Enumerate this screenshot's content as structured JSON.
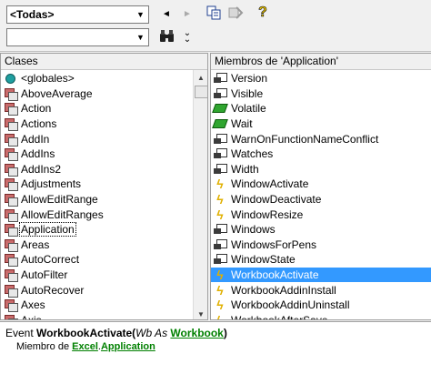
{
  "toolbar": {
    "library_value": "<Todas>",
    "search_value": "",
    "back_glyph": "◄",
    "forward_glyph": "►",
    "help_glyph": "?"
  },
  "classes": {
    "header": "Clases",
    "items": [
      {
        "label": "<globales>",
        "icon": "globals-icon"
      },
      {
        "label": "AboveAverage",
        "icon": "class-icon"
      },
      {
        "label": "Action",
        "icon": "class-icon"
      },
      {
        "label": "Actions",
        "icon": "class-icon"
      },
      {
        "label": "AddIn",
        "icon": "class-icon"
      },
      {
        "label": "AddIns",
        "icon": "class-icon"
      },
      {
        "label": "AddIns2",
        "icon": "class-icon"
      },
      {
        "label": "Adjustments",
        "icon": "class-icon"
      },
      {
        "label": "AllowEditRange",
        "icon": "class-icon"
      },
      {
        "label": "AllowEditRanges",
        "icon": "class-icon"
      },
      {
        "label": "Application",
        "icon": "class-icon",
        "selected": true
      },
      {
        "label": "Areas",
        "icon": "class-icon"
      },
      {
        "label": "AutoCorrect",
        "icon": "class-icon"
      },
      {
        "label": "AutoFilter",
        "icon": "class-icon"
      },
      {
        "label": "AutoRecover",
        "icon": "class-icon"
      },
      {
        "label": "Axes",
        "icon": "class-icon"
      },
      {
        "label": "Axis",
        "icon": "class-icon"
      }
    ]
  },
  "members": {
    "header": "Miembros de 'Application'",
    "items": [
      {
        "label": "Version",
        "icon": "property-icon"
      },
      {
        "label": "Visible",
        "icon": "property-icon"
      },
      {
        "label": "Volatile",
        "icon": "method-icon"
      },
      {
        "label": "Wait",
        "icon": "method-icon"
      },
      {
        "label": "WarnOnFunctionNameConflict",
        "icon": "property-icon"
      },
      {
        "label": "Watches",
        "icon": "property-icon"
      },
      {
        "label": "Width",
        "icon": "property-icon"
      },
      {
        "label": "WindowActivate",
        "icon": "event-icon"
      },
      {
        "label": "WindowDeactivate",
        "icon": "event-icon"
      },
      {
        "label": "WindowResize",
        "icon": "event-icon"
      },
      {
        "label": "Windows",
        "icon": "property-icon"
      },
      {
        "label": "WindowsForPens",
        "icon": "property-icon"
      },
      {
        "label": "WindowState",
        "icon": "property-icon"
      },
      {
        "label": "WorkbookActivate",
        "icon": "event-icon",
        "highlight": true
      },
      {
        "label": "WorkbookAddinInstall",
        "icon": "event-icon"
      },
      {
        "label": "WorkbookAddinUninstall",
        "icon": "event-icon"
      },
      {
        "label": "WorkbookAfterSave",
        "icon": "event-icon"
      }
    ]
  },
  "details": {
    "kind": "Event ",
    "name": "WorkbookActivate",
    "open_paren": "(",
    "param": "Wb As ",
    "type": "Workbook",
    "close_paren": ")",
    "member_of_label": "Miembro de ",
    "library": "Excel",
    "dot": ".",
    "class": "Application"
  }
}
